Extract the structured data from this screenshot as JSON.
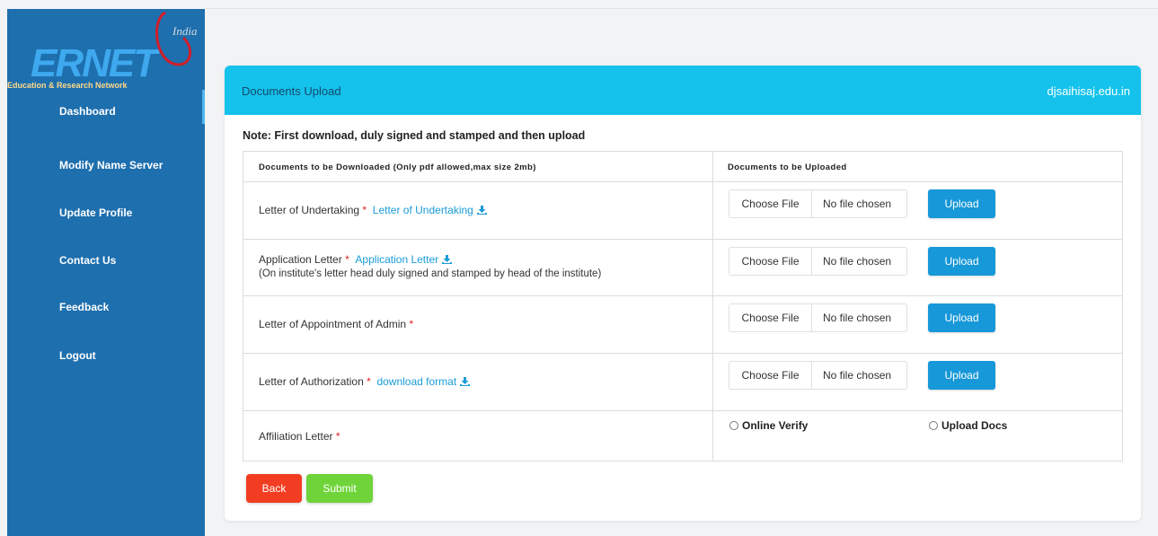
{
  "sidebar": {
    "logo_text": "ERNET",
    "logo_tag": "India",
    "logo_subtitle": "Education & Research Network",
    "items": [
      {
        "label": "Dashboard"
      },
      {
        "label": "Modify Name Server"
      },
      {
        "label": "Update Profile"
      },
      {
        "label": "Contact Us"
      },
      {
        "label": "Feedback"
      },
      {
        "label": "Logout"
      }
    ]
  },
  "card": {
    "title": "Documents Upload",
    "domain": "djsaihisaj.edu.in",
    "note": "Note: First download, duly signed and stamped and then upload"
  },
  "table": {
    "headers": {
      "download": "Documents to be Downloaded (Only pdf allowed,max size 2mb)",
      "upload": "Documents to be Uploaded"
    },
    "rows": [
      {
        "label": "Letter of Undertaking",
        "required": "*",
        "link": "Letter of Undertaking"
      },
      {
        "label": "Application Letter",
        "required": "*",
        "link": "Application Letter",
        "subnote": "(On institute's letter head duly signed and stamped by head of the institute)"
      },
      {
        "label": "Letter of Appointment of Admin",
        "required": "*"
      },
      {
        "label": "Letter of Authorization",
        "required": "*",
        "link": "download format"
      },
      {
        "label": "Affiliation Letter",
        "required": "*"
      }
    ],
    "file_input": {
      "button": "Choose File",
      "status": "No file chosen",
      "upload": "Upload"
    },
    "affiliation_options": [
      "Online Verify",
      "Upload Docs"
    ]
  },
  "actions": {
    "back": "Back",
    "submit": "Submit"
  },
  "colors": {
    "sidebar": "#1e6fae",
    "header": "#14c2ec",
    "upload": "#1798d8",
    "back": "#f23d22",
    "submit": "#6fd43a",
    "link": "#1a9cd8"
  }
}
